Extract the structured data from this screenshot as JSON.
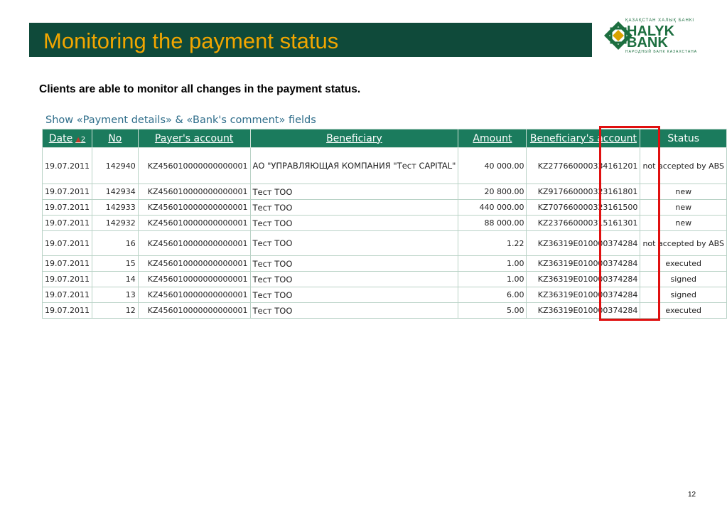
{
  "header": {
    "title": "Monitoring the payment status"
  },
  "logo": {
    "top_text": "ҚАЗАҚСТАН ХАЛЫҚ БАНКІ",
    "line1": "HALYK",
    "line2": "BANK",
    "bottom_text": "НАРОДНЫЙ БАНК КАЗАХСТАНА",
    "brand_color": "#1c6e3f"
  },
  "intro_text": "Clients are able to monitor all changes in the payment status.",
  "show_fields_link": "Show «Payment details» & «Bank's comment» fields",
  "table": {
    "sort_number": "2",
    "columns": [
      "Date",
      "No",
      "Payer's account",
      "Beneficiary",
      "Amount",
      "Beneficiary's account",
      "Status"
    ],
    "rows": [
      {
        "date": "19.07.2011",
        "no": "142940",
        "payer": "KZ456010000000000001",
        "beneficiary": "АО \"УПРАВЛЯЮЩАЯ КОМПАНИЯ \"Тест CAPITAL\"",
        "amount": "40 000.00",
        "benef_account": "KZ277660000334161201",
        "status": "not accepted by ABS"
      },
      {
        "date": "19.07.2011",
        "no": "142934",
        "payer": "KZ456010000000000001",
        "beneficiary": "Тест ТОО",
        "amount": "20 800.00",
        "benef_account": "KZ917660000323161801",
        "status": "new"
      },
      {
        "date": "19.07.2011",
        "no": "142933",
        "payer": "KZ456010000000000001",
        "beneficiary": "Тест ТОО",
        "amount": "440 000.00",
        "benef_account": "KZ707660000323161500",
        "status": "new"
      },
      {
        "date": "19.07.2011",
        "no": "142932",
        "payer": "KZ456010000000000001",
        "beneficiary": "Тест ТОО",
        "amount": "88 000.00",
        "benef_account": "KZ237660000315161301",
        "status": "new"
      },
      {
        "date": "19.07.2011",
        "no": "16",
        "payer": "KZ456010000000000001",
        "beneficiary": "Тест ТОО",
        "amount": "1.22",
        "benef_account": "KZ36319E010000374284",
        "status": "not accepted by ABS"
      },
      {
        "date": "19.07.2011",
        "no": "15",
        "payer": "KZ456010000000000001",
        "beneficiary": "Тест ТОО",
        "amount": "1.00",
        "benef_account": "KZ36319E010000374284",
        "status": "executed"
      },
      {
        "date": "19.07.2011",
        "no": "14",
        "payer": "KZ456010000000000001",
        "beneficiary": "Тест ТОО",
        "amount": "1.00",
        "benef_account": "KZ36319E010000374284",
        "status": "signed"
      },
      {
        "date": "19.07.2011",
        "no": "13",
        "payer": "KZ456010000000000001",
        "beneficiary": "Тест ТОО",
        "amount": "6.00",
        "benef_account": "KZ36319E010000374284",
        "status": "signed"
      },
      {
        "date": "19.07.2011",
        "no": "12",
        "payer": "KZ456010000000000001",
        "beneficiary": "Тест ТОО",
        "amount": "5.00",
        "benef_account": "KZ36319E010000374284",
        "status": "executed"
      }
    ]
  },
  "colors": {
    "header_bg": "#0f4a3a",
    "title_color": "#f2a600",
    "table_header_bg": "#1b7b5d",
    "highlight_frame": "#e01010"
  },
  "page_number": "12"
}
